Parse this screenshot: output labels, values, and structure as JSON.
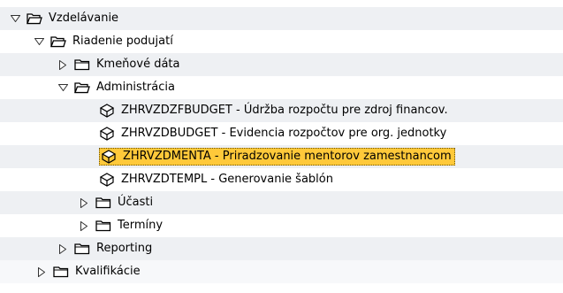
{
  "tree": {
    "vzdelavanie": {
      "label": "Vzdelávanie",
      "icon": "folder-open-icon",
      "state": "expanded"
    },
    "riadenie": {
      "label": "Riadenie podujatí",
      "icon": "folder-open-icon",
      "state": "expanded"
    },
    "kmenove": {
      "label": "Kmeňové dáta",
      "icon": "folder-icon",
      "state": "collapsed"
    },
    "administracia": {
      "label": "Administrácia",
      "icon": "folder-open-icon",
      "state": "expanded"
    },
    "zfbudget": {
      "label": "ZHRVZDZFBUDGET - Údržba rozpočtu pre zdroj financov.",
      "icon": "transaction-icon"
    },
    "budget": {
      "label": "ZHRVZDBUDGET - Evidencia rozpočtov pre org. jednotky",
      "icon": "transaction-icon"
    },
    "menta": {
      "label": "ZHRVZDMENTA - Priradzovanie mentorov zamestnancom",
      "icon": "transaction-icon",
      "selected": true
    },
    "templ": {
      "label": "ZHRVZDTEMPL - Generovanie šablón",
      "icon": "transaction-icon"
    },
    "ucasti": {
      "label": "Účasti",
      "icon": "folder-icon",
      "state": "collapsed"
    },
    "terminy": {
      "label": "Termíny",
      "icon": "folder-icon",
      "state": "collapsed"
    },
    "reporting": {
      "label": "Reporting",
      "icon": "folder-icon",
      "state": "collapsed"
    },
    "kvalifikacie": {
      "label": "Kvalifikácie",
      "icon": "folder-icon",
      "state": "collapsed"
    }
  },
  "colors": {
    "selection": "#ffc93a",
    "row_alt": "#eef0f3"
  }
}
